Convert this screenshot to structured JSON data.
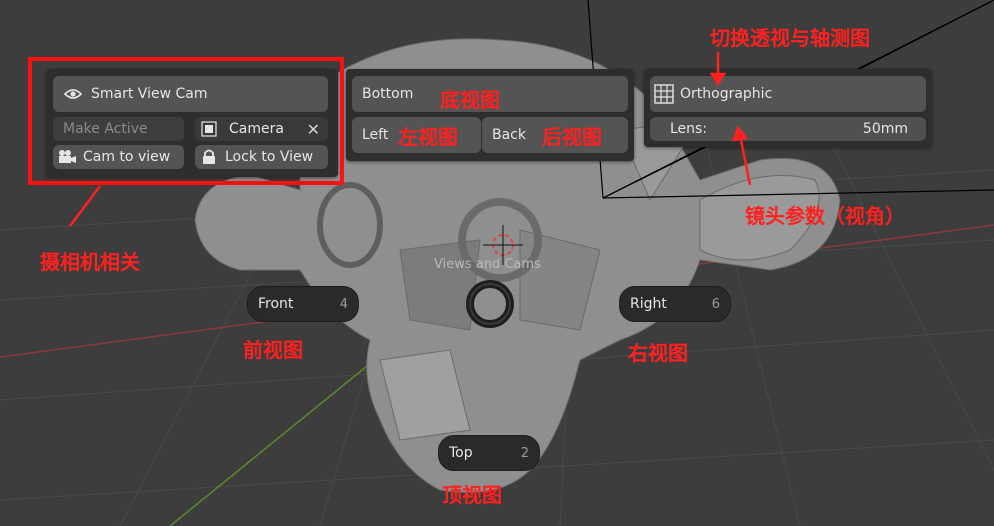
{
  "camera_panel": {
    "smart_view_cam": "Smart View Cam",
    "make_active": "Make Active",
    "camera_name": "Camera",
    "cam_to_view": "Cam to view",
    "lock_to_view": "Lock to View"
  },
  "views_panel": {
    "bottom": "Bottom",
    "left": "Left",
    "back": "Back"
  },
  "ortho_panel": {
    "orthographic": "Orthographic",
    "lens_label": "Lens:",
    "lens_value": "50mm"
  },
  "pie": {
    "title": "Views and Cams",
    "front": "Front",
    "front_key": "4",
    "right": "Right",
    "right_key": "6",
    "top": "Top",
    "top_key": "2"
  },
  "annotations": {
    "camera_related": "摄相机相关",
    "bottom_view": "底视图",
    "left_view": "左视图",
    "back_view": "后视图",
    "toggle_persp_ortho": "切换透视与轴测图",
    "lens_params": "镜头参数（视角）",
    "front_view": "前视图",
    "right_view": "右视图",
    "top_view": "顶视图"
  },
  "colors": {
    "annotation": "#ff2020",
    "panel_bg": "#2e2e2e",
    "button_bg": "#545454",
    "viewport_bg": "#3d3d3d"
  }
}
